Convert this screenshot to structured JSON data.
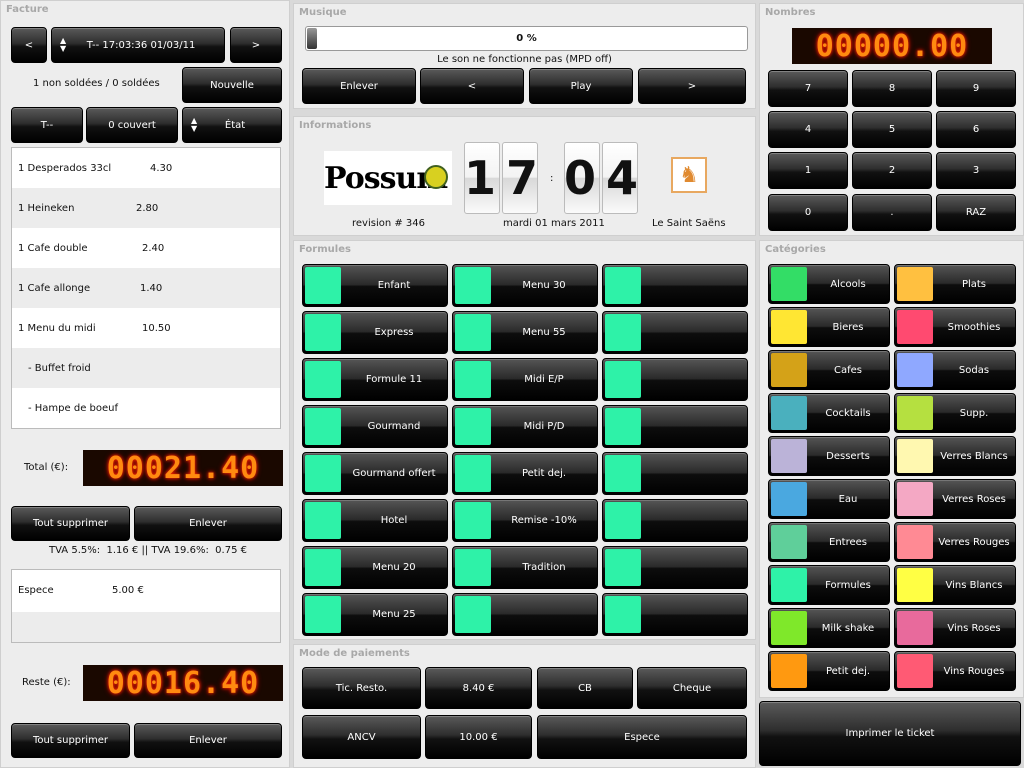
{
  "facture": {
    "title": "Facture",
    "prev_label": "<",
    "next_label": ">",
    "ticket_id": "T-- 17:03:36 01/03/11",
    "status_counts": "1 non soldées / 0 soldées",
    "new_label": "Nouvelle",
    "table_label": "T--",
    "covers_label": "0 couvert",
    "state_label": "État",
    "items": [
      {
        "name": "1 Desperados 33cl",
        "price": "4.30"
      },
      {
        "name": "1 Heineken",
        "price": "2.80"
      },
      {
        "name": "1 Cafe double",
        "price": "2.40"
      },
      {
        "name": "1 Cafe allonge",
        "price": "1.40"
      },
      {
        "name": "1 Menu du midi",
        "price": "10.50"
      },
      {
        "name": "- Buffet froid",
        "price": ""
      },
      {
        "name": "- Hampe de boeuf",
        "price": ""
      }
    ],
    "total_label": "Total (€):",
    "total_display": "00021.40",
    "delete_all_label": "Tout supprimer",
    "remove_label": "Enlever",
    "tva_text": "TVA 5.5%:  1.16 € || TVA 19.6%:  0.75 €",
    "payments": [
      {
        "name": "Espece",
        "amount": "5.00 €"
      }
    ],
    "remaining_label": "Reste (€):",
    "remaining_display": "00016.40",
    "delete_all_label2": "Tout supprimer",
    "remove_label2": "Enlever"
  },
  "musique": {
    "title": "Musique",
    "progress_pct": 0,
    "progress_text": "0 %",
    "status_text": "Le son ne fonctionne pas (MPD off)",
    "buttons": [
      "Enlever",
      "<",
      "Play",
      ">"
    ]
  },
  "informations": {
    "title": "Informations",
    "logo_text": "Possum",
    "revision": "revision # 346",
    "hour": "17",
    "minute": "04",
    "colon": ":",
    "date": "mardi 01 mars 2011",
    "venue": "Le Saint Saëns"
  },
  "nombres": {
    "title": "Nombres",
    "display": "00000.00",
    "keys": [
      "7",
      "8",
      "9",
      "4",
      "5",
      "6",
      "1",
      "2",
      "3",
      "0",
      ".",
      "RAZ"
    ]
  },
  "formules": {
    "title": "Formules",
    "swatch_color": "#2ef2a8",
    "col1": [
      "Enfant",
      "Express",
      "Formule 11",
      "Gourmand",
      "Gourmand offert",
      "Hotel",
      "Menu 20",
      "Menu 25"
    ],
    "col2": [
      "Menu 30",
      "Menu 55",
      "Midi E/P",
      "Midi P/D",
      "Petit dej.",
      "Remise -10%",
      "Tradition",
      ""
    ],
    "col3": [
      "",
      "",
      "",
      "",
      "",
      "",
      "",
      ""
    ]
  },
  "categories": {
    "title": "Catégories",
    "left": [
      {
        "label": "Alcools",
        "color": "#33dd66"
      },
      {
        "label": "Bieres",
        "color": "#ffe633"
      },
      {
        "label": "Cafes",
        "color": "#d4a218"
      },
      {
        "label": "Cocktails",
        "color": "#4ab0be"
      },
      {
        "label": "Desserts",
        "color": "#bbb3d8"
      },
      {
        "label": "Eau",
        "color": "#4aa8e0"
      },
      {
        "label": "Entrees",
        "color": "#5fcf9a"
      },
      {
        "label": "Formules",
        "color": "#2ef2a8"
      },
      {
        "label": "Milk shake",
        "color": "#7fe82a"
      },
      {
        "label": "Petit dej.",
        "color": "#ff9910"
      }
    ],
    "right": [
      {
        "label": "Plats",
        "color": "#ffc040"
      },
      {
        "label": "Smoothies",
        "color": "#ff4a70"
      },
      {
        "label": "Sodas",
        "color": "#8fa8ff"
      },
      {
        "label": "Supp.",
        "color": "#b5e040"
      },
      {
        "label": "Verres Blancs",
        "color": "#fff8b0"
      },
      {
        "label": "Verres Roses",
        "color": "#f4a8c4"
      },
      {
        "label": "Verres Rouges",
        "color": "#ff8a94"
      },
      {
        "label": "Vins Blancs",
        "color": "#ffff44"
      },
      {
        "label": "Vins Roses",
        "color": "#e86a9c"
      },
      {
        "label": "Vins Rouges",
        "color": "#ff5a74"
      }
    ]
  },
  "paiements": {
    "title": "Mode de paiements",
    "row1": [
      "Tic. Resto.",
      "8.40 €",
      "CB",
      "Cheque"
    ],
    "row2": [
      "ANCV",
      "10.00 €",
      "Espece"
    ]
  },
  "print_label": "Imprimer le ticket"
}
